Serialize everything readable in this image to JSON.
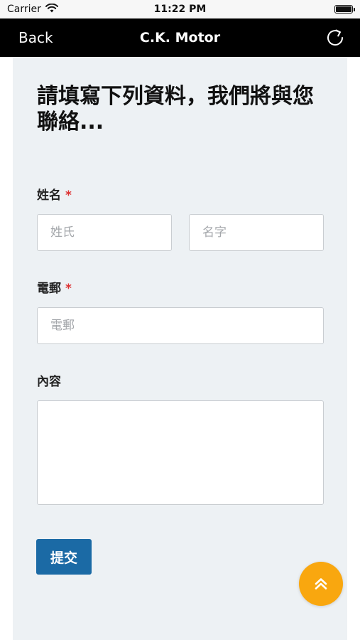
{
  "status_bar": {
    "carrier": "Carrier",
    "time": "11:22 PM"
  },
  "nav": {
    "back_label": "Back",
    "title": "C.K. Motor"
  },
  "form": {
    "heading": "請填寫下列資料，我們將與您聯絡...",
    "name_label": "姓名",
    "required_mark": "*",
    "last_name_placeholder": "姓氏",
    "first_name_placeholder": "名字",
    "email_label": "電郵",
    "email_placeholder": "電郵",
    "content_label": "內容",
    "content_value": "",
    "submit_label": "提交"
  },
  "colors": {
    "nav_background": "#000000",
    "form_background": "#edf1f4",
    "submit_button": "#1b6aa5",
    "fab": "#f9a70f",
    "required": "#dd3333"
  }
}
